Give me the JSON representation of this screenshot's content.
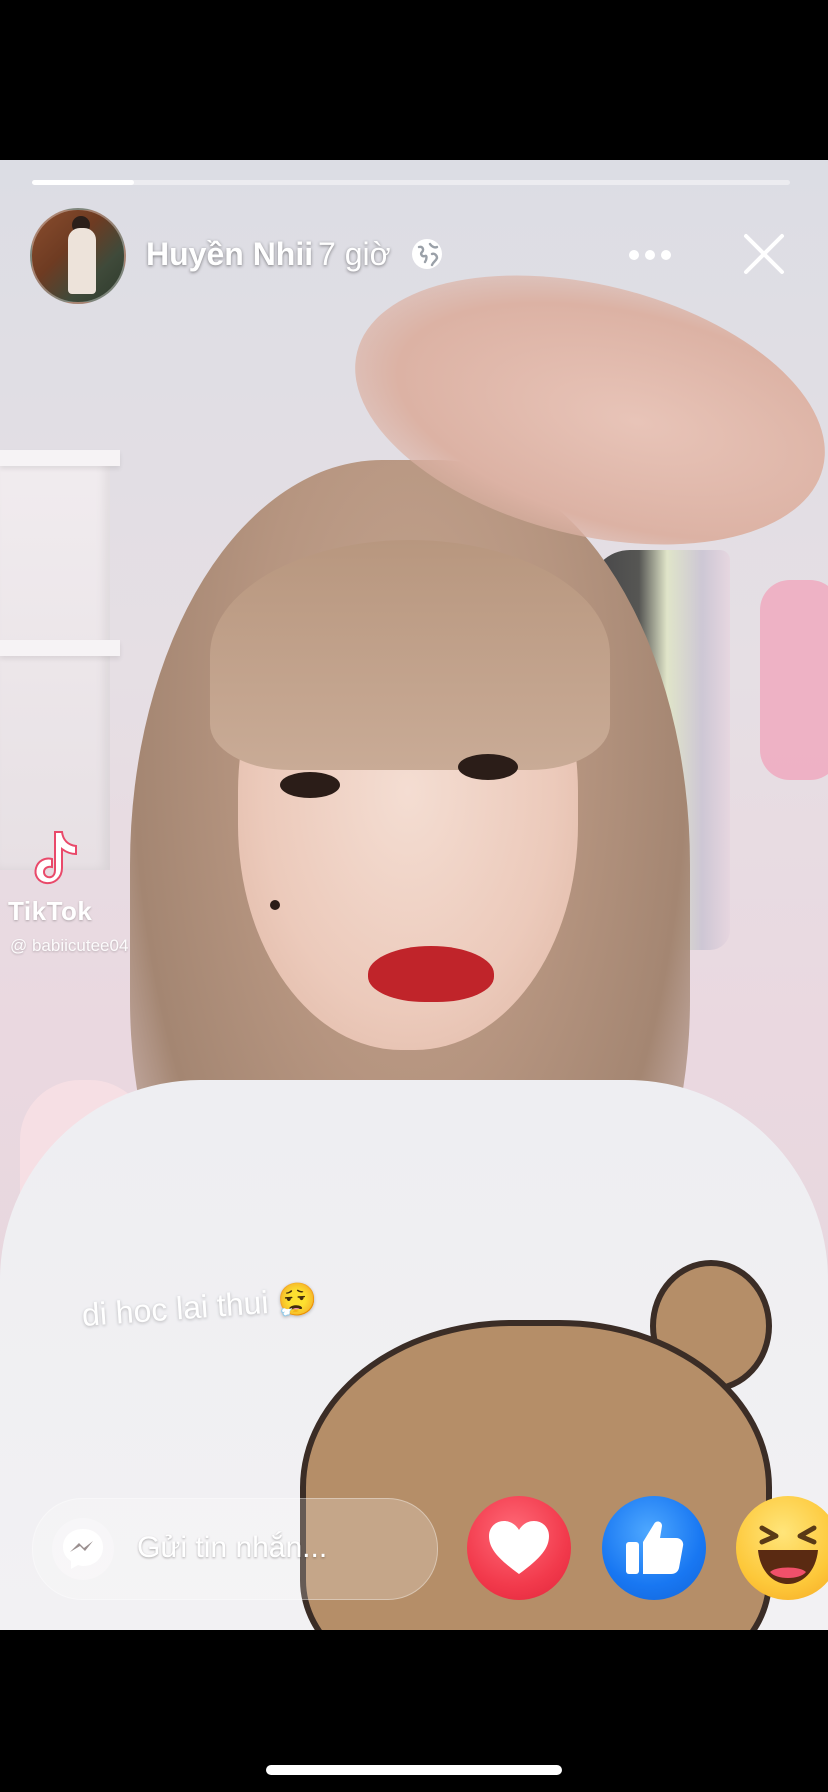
{
  "story": {
    "progress": 0.135,
    "user": {
      "name": "Huyền Nhii",
      "time": "7 giờ",
      "privacy_icon": "globe-icon"
    },
    "watermark": {
      "app": "TikTok",
      "handle": "@ babiicutee04"
    },
    "caption": "di hoc lai thui 😮‍💨"
  },
  "reply": {
    "placeholder": "Gửi tin nhắn...",
    "icon": "messenger-icon"
  },
  "reactions": [
    {
      "name": "love",
      "icon": "heart-icon",
      "color": "#f23a4c"
    },
    {
      "name": "like",
      "icon": "thumbs-up-icon",
      "color": "#1877f2"
    },
    {
      "name": "haha",
      "icon": "laughing-face-icon",
      "color": "#fdc83a"
    }
  ]
}
